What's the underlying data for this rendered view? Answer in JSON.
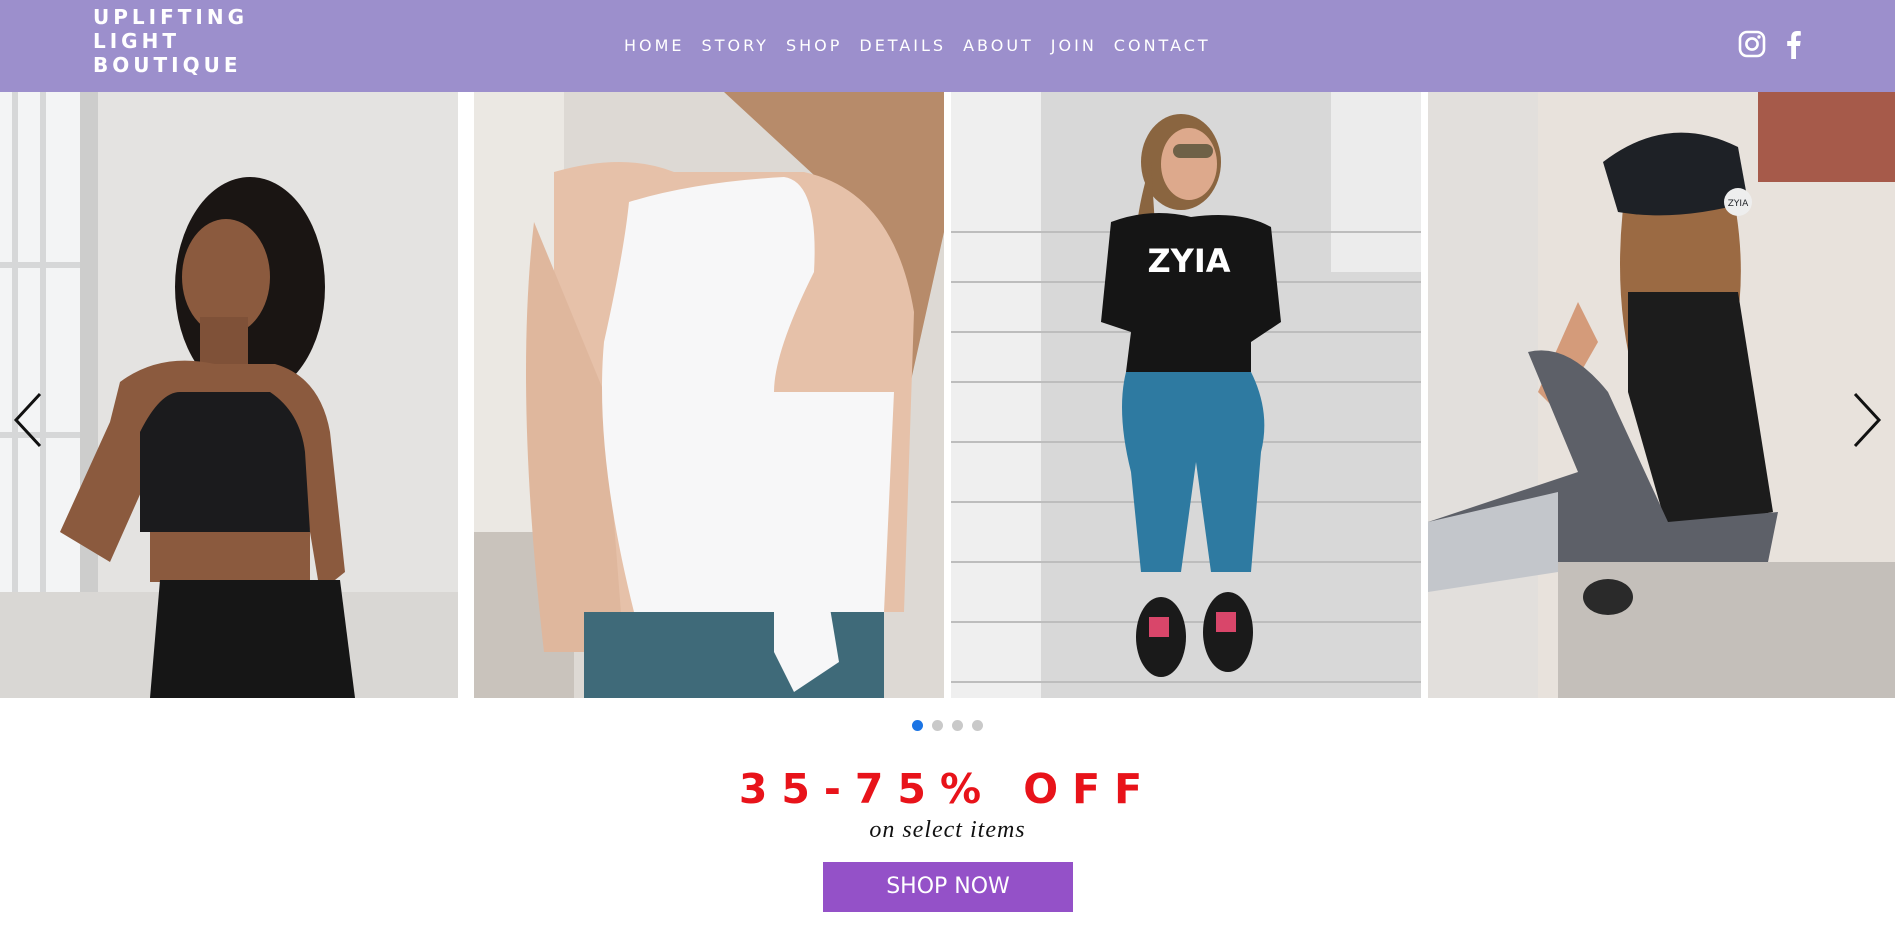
{
  "brand": {
    "line1": "UPLIFTING",
    "line2": "LIGHT",
    "line3": "BOUTIQUE"
  },
  "nav": {
    "items": [
      "HOME",
      "STORY",
      "SHOP",
      "DETAILS",
      "ABOUT",
      "JOIN",
      "CONTACT"
    ]
  },
  "social": {
    "instagram": "instagram-icon",
    "facebook": "facebook-icon"
  },
  "gallery": {
    "photos": [
      {
        "subject": "woman in black sports bra by window"
      },
      {
        "subject": "back of white tie-front tank top"
      },
      {
        "subject": "woman in ZYIA crop top sitting on stairs",
        "shirt_text": "ZYIA"
      },
      {
        "subject": "woman in cap and black tank sitting on ledge",
        "cap_text": "ZYIA"
      }
    ],
    "prev_icon": "chevron-left-icon",
    "next_icon": "chevron-right-icon",
    "slide_count": 4,
    "active_slide": 1
  },
  "promo": {
    "headline": "35-75% OFF",
    "subline": "on select items",
    "button": "SHOP NOW"
  },
  "colors": {
    "header": "#9c8fcc",
    "headline": "#e8131a",
    "button": "#9451c8",
    "active_dot": "#1b74e4",
    "inactive_dot": "#c9c9c9"
  }
}
